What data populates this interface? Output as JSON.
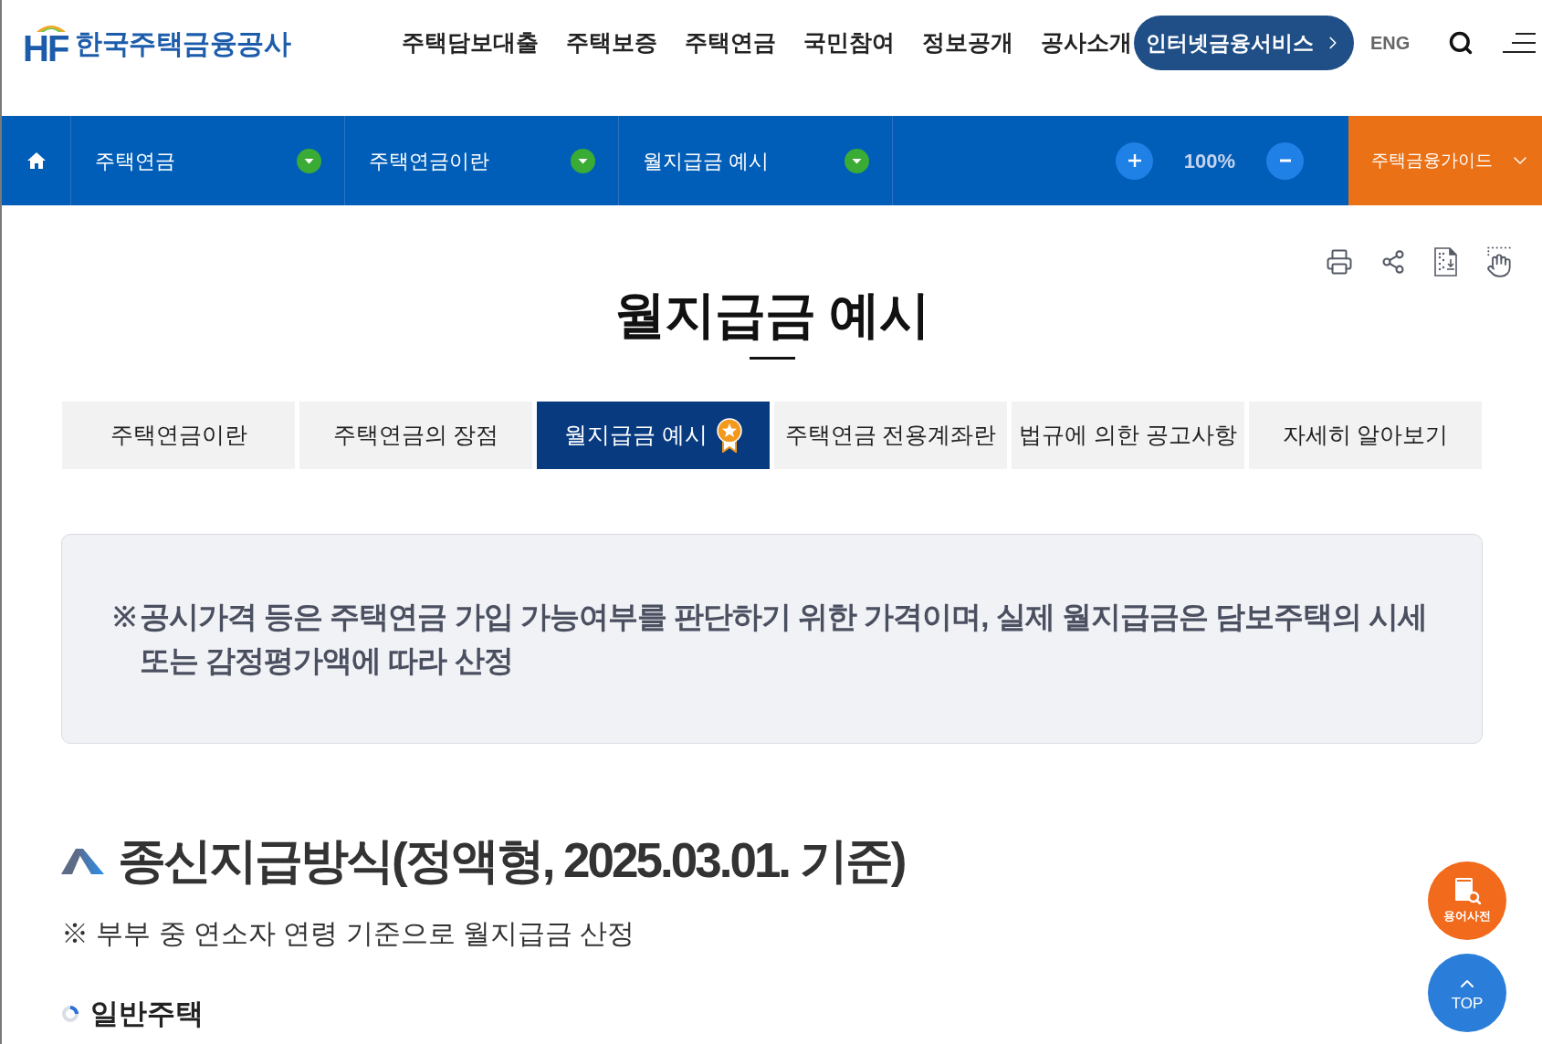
{
  "header": {
    "logo": {
      "mark": "HF",
      "name": "한국주택금융공사"
    },
    "nav": [
      "주택담보대출",
      "주택보증",
      "주택연금",
      "국민참여",
      "정보공개",
      "공사소개"
    ],
    "service_button": "인터넷금융서비스",
    "language": "ENG"
  },
  "location_bar": {
    "items": [
      "주택연금",
      "주택연금이란",
      "월지급금 예시"
    ],
    "zoom": "100%",
    "guide": "주택금융가이드"
  },
  "page_title": "월지급금 예시",
  "tabs": [
    {
      "label": "주택연금이란",
      "selected": false
    },
    {
      "label": "주택연금의 장점",
      "selected": false
    },
    {
      "label": "월지급금 예시",
      "selected": true
    },
    {
      "label": "주택연금 전용계좌란",
      "selected": false
    },
    {
      "label": "법규에 의한 공고사항",
      "selected": false
    },
    {
      "label": "자세히 알아보기",
      "selected": false
    }
  ],
  "notice": {
    "mark": "※",
    "text": "공시가격 등은 주택연금 가입 가능여부를 판단하기 위한 가격이며, 실제 월지급금은 담보주택의 시세 또는 감정평가액에 따라 산정"
  },
  "section": {
    "title": "종신지급방식(정액형, 2025.03.01. 기준)",
    "note": "※ 부부 중 연소자 연령 기준으로 월지급금 산정",
    "subheading": "일반주택"
  },
  "floating_buttons": {
    "glossary": "용어사전",
    "top": "TOP"
  }
}
